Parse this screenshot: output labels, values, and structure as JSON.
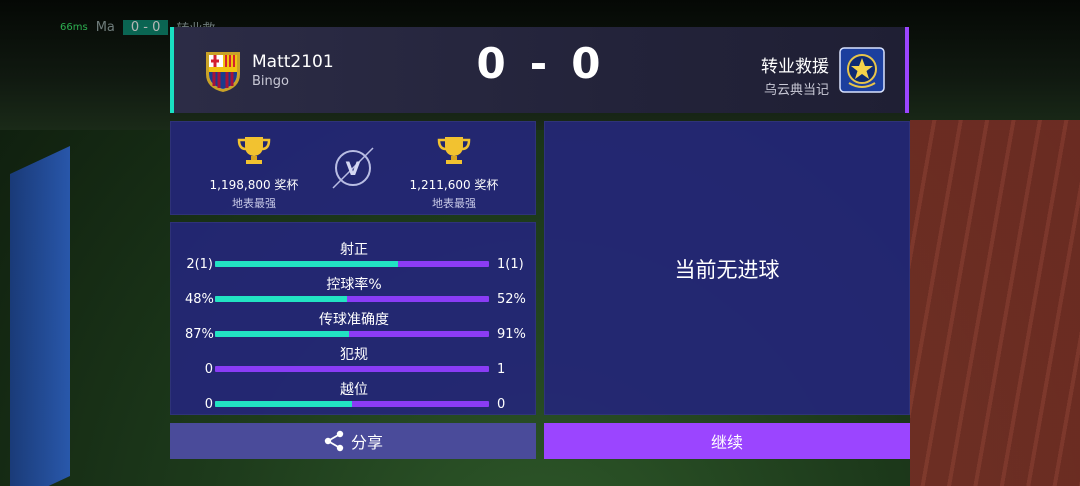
{
  "hud": {
    "ping": "66ms",
    "mini_score": "0 - 0",
    "mini_home": "Ma",
    "mini_away": "转业救"
  },
  "match": {
    "home": {
      "name": "Matt2101",
      "subtitle": "Bingo",
      "crest": "fcb-crest-icon"
    },
    "away": {
      "name": "转业救援",
      "subtitle": "乌云典当记",
      "crest": "star-shield-crest-icon"
    },
    "score_home": "0",
    "score_sep": "-",
    "score_away": "0"
  },
  "trophies": {
    "home": {
      "value": "1,198,800 奖杯",
      "label": "地表最强"
    },
    "away": {
      "value": "1,211,600 奖杯",
      "label": "地表最强"
    },
    "vs": "V"
  },
  "stats": [
    {
      "title": "射正",
      "home": "2(1)",
      "away": "1(1)",
      "home_share": 0.667
    },
    {
      "title": "控球率%",
      "home": "48%",
      "away": "52%",
      "home_share": 0.48
    },
    {
      "title": "传球准确度",
      "home": "87%",
      "away": "91%",
      "home_share": 0.49
    },
    {
      "title": "犯规",
      "home": "0",
      "away": "1",
      "home_share": 0.0
    },
    {
      "title": "越位",
      "home": "0",
      "away": "0",
      "home_share": 0.5
    }
  ],
  "goals": {
    "message": "当前无进球"
  },
  "buttons": {
    "share": "分享",
    "continue": "继续"
  },
  "colors": {
    "home_bar": "#22e3c3",
    "away_bar": "#8a3cf5",
    "accent": "#9b45ff",
    "panel": "#24267a"
  }
}
